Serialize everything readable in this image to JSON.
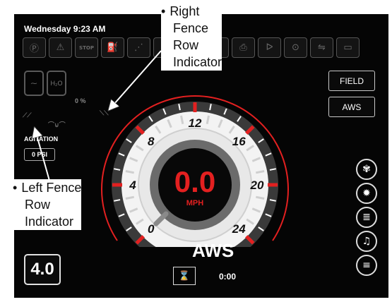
{
  "header": {
    "datetime": "Wednesday 9:23 AM"
  },
  "status_icons": [
    {
      "name": "park-icon",
      "glyph": "Ⓟ"
    },
    {
      "name": "warning-icon",
      "glyph": "⚠"
    },
    {
      "name": "stop-icon",
      "glyph": "STOP"
    },
    {
      "name": "tank-fill-icon",
      "glyph": "⛽"
    },
    {
      "name": "spray-icon",
      "glyph": "⋰"
    },
    {
      "name": "boom-icon",
      "glyph": "⫶"
    },
    {
      "name": "nozzle-icon",
      "glyph": "⊹"
    },
    {
      "name": "rinse-icon",
      "glyph": "⇶"
    },
    {
      "name": "pump-icon",
      "glyph": "⎙"
    },
    {
      "name": "valve-icon",
      "glyph": "ᐅ"
    },
    {
      "name": "flow-icon",
      "glyph": "⊙"
    },
    {
      "name": "hose-icon",
      "glyph": "⇋"
    },
    {
      "name": "tank-empty-icon",
      "glyph": "▭"
    }
  ],
  "buttons": {
    "field": "FIELD",
    "aws": "AWS"
  },
  "tanks": {
    "left": "⁓",
    "right": "H₂O"
  },
  "fan_percent": "0 %",
  "agitation": {
    "label": "AGITATION",
    "value": "0 PSI"
  },
  "speedometer": {
    "speed": "0.0",
    "unit": "MPH",
    "ticks": [
      "0",
      "4",
      "8",
      "12",
      "16",
      "20",
      "24"
    ],
    "needle_value": 0
  },
  "mode_label": "AWS",
  "timer": "0:00",
  "big_value": "4.0",
  "side_buttons": [
    {
      "name": "fan-button",
      "glyph": "✾"
    },
    {
      "name": "light-button",
      "glyph": "✹"
    },
    {
      "name": "headlight-button",
      "glyph": "≣"
    },
    {
      "name": "music-button",
      "glyph": "♫"
    },
    {
      "name": "menu-button",
      "glyph": "≡"
    }
  ],
  "annotations": {
    "right_fence": [
      "Right",
      "Fence",
      "Row",
      "Indicator"
    ],
    "left_fence_first": "Left",
    "left_fence_second": "Fence",
    "left_fence_rest": [
      "Row",
      "Indicator"
    ]
  }
}
